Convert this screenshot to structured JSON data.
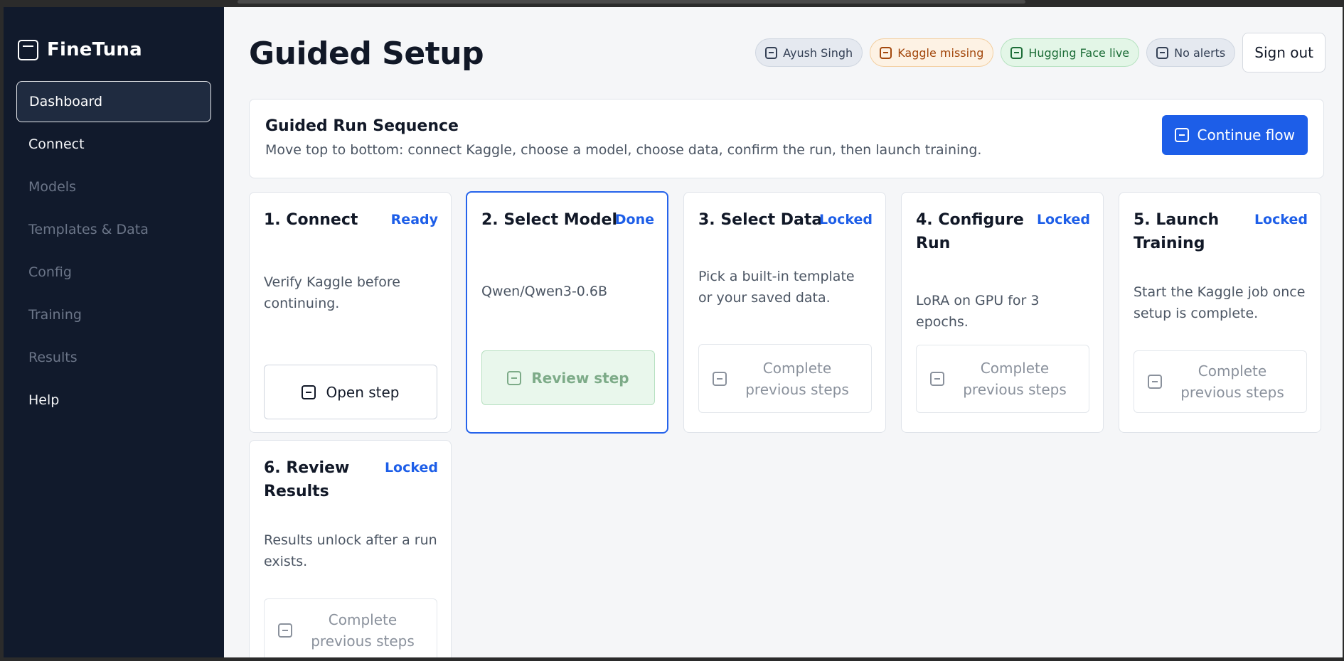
{
  "brand": {
    "name": "FineTuna"
  },
  "sidebar": {
    "items": [
      {
        "label": "Dashboard",
        "active": true,
        "enabled": true
      },
      {
        "label": "Connect",
        "active": false,
        "enabled": true
      },
      {
        "label": "Models",
        "active": false,
        "enabled": false
      },
      {
        "label": "Templates & Data",
        "active": false,
        "enabled": false
      },
      {
        "label": "Config",
        "active": false,
        "enabled": false
      },
      {
        "label": "Training",
        "active": false,
        "enabled": false
      },
      {
        "label": "Results",
        "active": false,
        "enabled": false
      },
      {
        "label": "Help",
        "active": false,
        "enabled": true
      }
    ]
  },
  "header": {
    "title": "Guided Setup",
    "chips": {
      "user": "Ayush Singh",
      "kaggle": "Kaggle missing",
      "huggingface": "Hugging Face live",
      "alerts": "No alerts"
    },
    "signout_label": "Sign out"
  },
  "banner": {
    "title": "Guided Run Sequence",
    "description": "Move top to bottom: connect Kaggle, choose a model, choose data, confirm the run, then launch training.",
    "continue_label": "Continue flow"
  },
  "steps": [
    {
      "title": "1. Connect",
      "status": "Ready",
      "description": "Verify Kaggle before continuing.",
      "action": "Open step"
    },
    {
      "title": "2. Select Model",
      "status": "Done",
      "description": "Qwen/Qwen3-0.6B",
      "action": "Review step"
    },
    {
      "title": "3. Select Data",
      "status": "Locked",
      "description": "Pick a built-in template or your saved data.",
      "action": "Complete previous steps"
    },
    {
      "title": "4. Configure Run",
      "status": "Locked",
      "description": "LoRA on GPU for 3 epochs.",
      "action": "Complete previous steps"
    },
    {
      "title": "5. Launch Training",
      "status": "Locked",
      "description": "Start the Kaggle job once setup is complete.",
      "action": "Complete previous steps"
    },
    {
      "title": "6. Review Results",
      "status": "Locked",
      "description": "Results unlock after a run exists.",
      "action": "Complete previous steps"
    }
  ],
  "colors": {
    "sidebar_bg": "#111a2c",
    "accent": "#1d5ee8",
    "page_bg": "#f5f6f8",
    "warn": "#a3480d",
    "success": "#1c6d37"
  }
}
